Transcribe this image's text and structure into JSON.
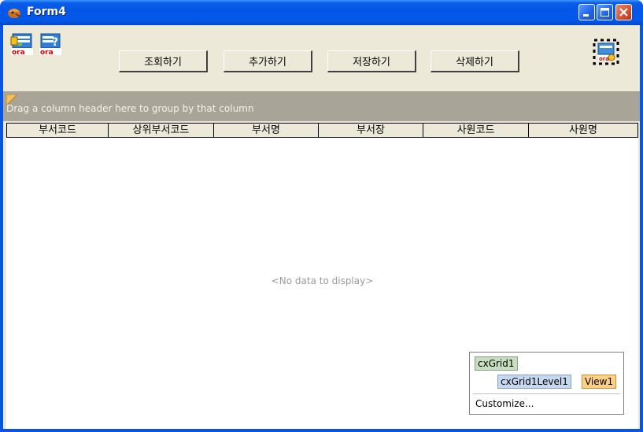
{
  "window": {
    "title": "Form4",
    "minimize_icon": "minimize-icon",
    "maximize_icon": "maximize-icon",
    "close_icon": "close-icon",
    "title_bar_color": "#0a54e3"
  },
  "toolbar": {
    "tool_icons": [
      "ora-connect-icon",
      "ora-query-icon"
    ],
    "buttons": {
      "query": "조회하기",
      "add": "추가하기",
      "save": "저장하기",
      "delete": "삭제하기"
    },
    "component_icon": "ora-component-icon"
  },
  "grid": {
    "group_panel_text": "Drag a column header here to group by that column",
    "columns": [
      "부서코드",
      "상위부서코드",
      "부서명",
      "부서장",
      "사원코드",
      "사원명"
    ],
    "no_data_text": "<No data to display>",
    "level_popup": {
      "grid_name": "cxGrid1",
      "level_name": "cxGrid1Level1",
      "view_name": "View1",
      "customize": "Customize..."
    }
  }
}
